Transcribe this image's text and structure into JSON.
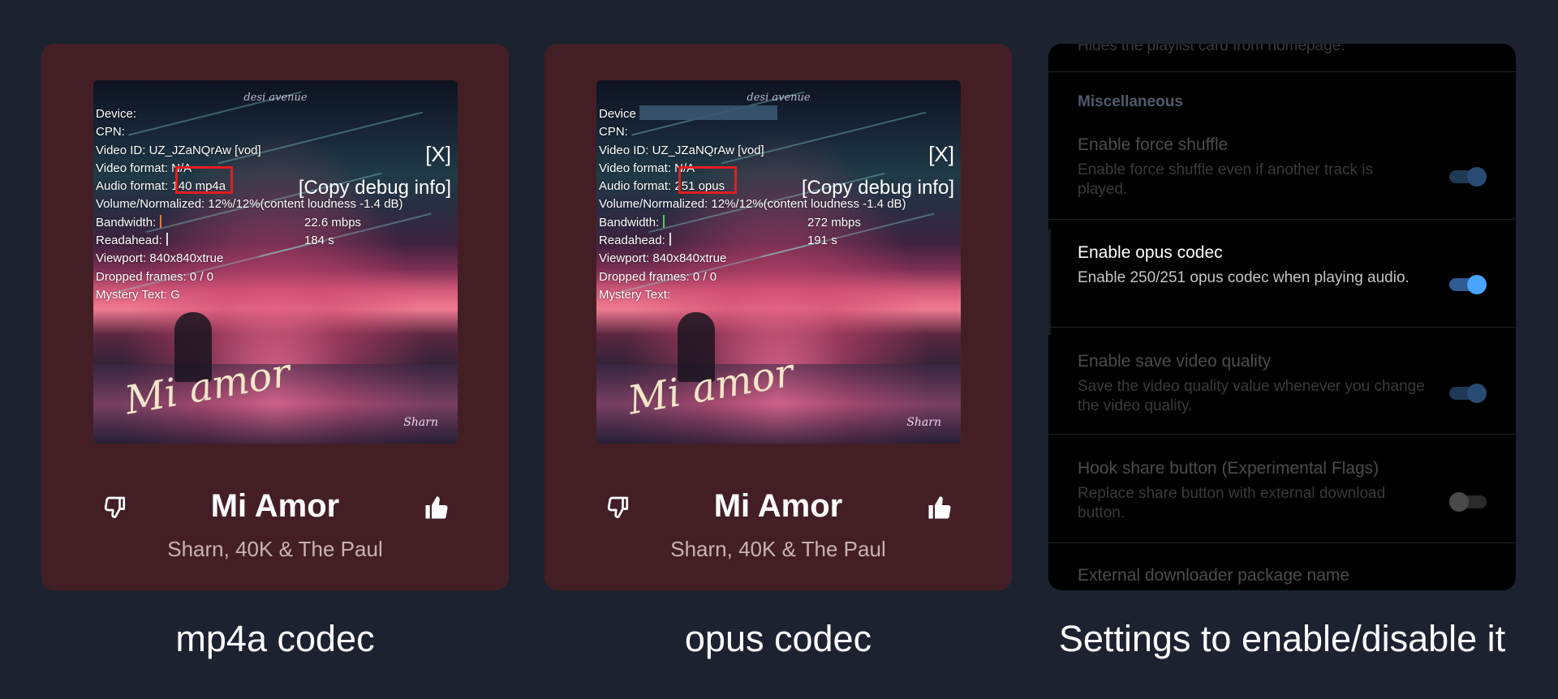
{
  "cards": [
    {
      "art_brand": "desi avenue",
      "art_script": "Mi amor",
      "art_signature": "Sharn",
      "debug": {
        "device": "Device:",
        "cpn": "CPN:",
        "video_id": "Video ID: UZ_JZaNQrAw [vod]",
        "video_format": "Video format: N/A",
        "audio_format_label": "Audio format:",
        "audio_format_value": "140 mp4a",
        "volume": "Volume/Normalized: 12%/12%(content loudness -1.4 dB)",
        "bandwidth_label": "Bandwidth:",
        "bandwidth_value": "22.6 mbps",
        "readahead_label": "Readahead:",
        "readahead_value": "184 s",
        "viewport": "Viewport: 840x840xtrue",
        "dropped": "Dropped frames: 0 / 0",
        "mystery": "Mystery Text: G",
        "close": "[X]",
        "copy": "[Copy debug info]"
      },
      "title": "Mi Amor",
      "artist": "Sharn, 40K & The Paul",
      "caption": "mp4a codec"
    },
    {
      "art_brand": "desi avenue",
      "art_script": "Mi amor",
      "art_signature": "Sharn",
      "debug": {
        "device": "Device",
        "cpn": "CPN:",
        "video_id": "Video ID: UZ_JZaNQrAw [vod]",
        "video_format": "Video format: N/A",
        "audio_format_label": "Audio format:",
        "audio_format_value": "251 opus",
        "volume": "Volume/Normalized: 12%/12%(content loudness -1.4 dB)",
        "bandwidth_label": "Bandwidth:",
        "bandwidth_value": "272 mbps",
        "readahead_label": "Readahead:",
        "readahead_value": "191 s",
        "viewport": "Viewport: 840x840xtrue",
        "dropped": "Dropped frames: 0 / 0",
        "mystery": "Mystery Text:",
        "close": "[X]",
        "copy": "[Copy debug info]"
      },
      "title": "Mi Amor",
      "artist": "Sharn, 40K & The Paul",
      "caption": "opus codec"
    }
  ],
  "settings": {
    "cut_text": "Hides the playlist card from homepage.",
    "section": "Miscellaneous",
    "items": [
      {
        "title": "Enable force shuffle",
        "desc": "Enable force shuffle even if another track is played.",
        "enabled": true
      },
      {
        "title": "Enable opus codec",
        "desc": "Enable 250/251 opus codec when playing audio.",
        "enabled": true
      },
      {
        "title": "Enable save video quality",
        "desc": "Save the video quality value whenever you change the video quality.",
        "enabled": true
      },
      {
        "title": "Hook share button (Experimental Flags)",
        "desc": "Replace share button with external download button.",
        "enabled": false
      },
      {
        "title": "External downloader package name",
        "desc": "",
        "enabled": null
      }
    ],
    "caption": "Settings to enable/disable it"
  },
  "colors": {
    "page_bg": "#1c2230",
    "card_bg": "#431f25",
    "highlight": "#e21e1e",
    "toggle_accent": "#4aa3ff"
  },
  "icons": [
    "thumbs-down-icon",
    "thumbs-up-icon"
  ]
}
